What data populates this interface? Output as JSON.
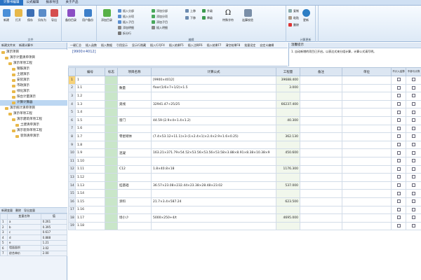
{
  "tabs": [
    "计算书编辑",
    "公式编辑",
    "报表导出",
    "关于产品"
  ],
  "ribbon": {
    "file_group": {
      "title": "文件",
      "buttons": [
        "新建",
        "打开",
        "保存",
        "另存为",
        "导出"
      ]
    },
    "user_group": {
      "buttons": [
        "备份目录",
        "用户备份"
      ]
    },
    "edit_group": {
      "title": "编辑",
      "big_button": "添加目录",
      "small_buttons": [
        "插入分部",
        "插入分项",
        "插入子目",
        "添加分部",
        "添加分项",
        "添加子目",
        "插入明细",
        "添加明细",
        "拆分行"
      ],
      "arrow_buttons": [
        "上移",
        "下移",
        "升级",
        "降级"
      ],
      "symbols_label": "特殊字符",
      "calc_label": "连算校验"
    },
    "delete_group": {
      "buttons": [
        "复制",
        "粘贴",
        "删除"
      ]
    },
    "update_group": {
      "title": "计算更新",
      "button": "更新"
    }
  },
  "left_panel": {
    "toolbar": [
      "新建文件夹",
      "新建计算书"
    ],
    "tree": [
      {
        "label": "演示项目",
        "level": 0
      },
      {
        "label": "演示计量清单项目",
        "level": 1
      },
      {
        "label": "演示单项工程",
        "level": 2
      },
      {
        "label": "钢筋演示",
        "level": 3
      },
      {
        "label": "土建演示",
        "level": 3
      },
      {
        "label": "安装演示",
        "level": 3
      },
      {
        "label": "市政演示",
        "level": 3
      },
      {
        "label": "绿化演示",
        "level": 3
      },
      {
        "label": "阳台计量演示",
        "level": 3
      },
      {
        "label": "计算计算器",
        "level": 3,
        "selected": true
      },
      {
        "label": "演示统计清单项目",
        "level": 1
      },
      {
        "label": "演示单项工程",
        "level": 2
      },
      {
        "label": "演示建筑单项工程",
        "level": 3
      },
      {
        "label": "土建清单演示",
        "level": 4
      },
      {
        "label": "演示装饰单项工程",
        "level": 3
      },
      {
        "label": "装饰清单演示",
        "level": 4
      }
    ],
    "bottom_toolbar": [
      "新建变量",
      "删除",
      "导出变量"
    ],
    "var_headers": [
      "变量名称",
      "值"
    ],
    "variables": [
      {
        "idx": "1",
        "name": "a",
        "value": "0.261"
      },
      {
        "idx": "2",
        "name": "b",
        "value": "0.395"
      },
      {
        "idx": "3",
        "name": "c",
        "value": "0.617"
      },
      {
        "idx": "4",
        "name": "d",
        "value": "0.888"
      },
      {
        "idx": "5",
        "name": "e",
        "value": "1.21"
      },
      {
        "idx": "6",
        "name": "墙面面积",
        "value": "3.02"
      },
      {
        "idx": "7",
        "name": "综合单价",
        "value": "2.00"
      }
    ]
  },
  "formula_bar": {
    "tools": [
      "一键汇总",
      "插入函数",
      "插入数据",
      "引用显示",
      "显示行隐藏",
      "插入行号F4",
      "插入结果F5",
      "插入注释F6",
      "插入结果F7",
      "清空结果F8",
      "批量设定",
      "自定义编辑"
    ],
    "value": "[9900×4012]"
  },
  "reminder": {
    "title": "温馨提示",
    "body": "1. 自动新增的项目已开启。以表达式来分组计算，计算公式请写明。"
  },
  "grid": {
    "headers": [
      "编号",
      "标志",
      "项目名称",
      "计算公式",
      "工程量",
      "备注",
      "单位",
      "不计入结算",
      "不参与计算"
    ],
    "rows": [
      {
        "rn": "1",
        "code": "1",
        "name": "",
        "formula": "[9900×4012]",
        "qty": "39688.400",
        "selected": true
      },
      {
        "rn": "2",
        "code": "1.1",
        "name": "数量",
        "formula": "floor(1/6×7+1/2)×1.5",
        "qty": "3.000"
      },
      {
        "rn": "3",
        "code": "1.2",
        "name": "",
        "formula": "",
        "qty": ""
      },
      {
        "rn": "4",
        "code": "1.3",
        "name": "奥线",
        "formula": "32941.47÷25/25",
        "qty": "66237.400"
      },
      {
        "rn": "5",
        "code": "1.4",
        "name": "",
        "formula": "",
        "qty": ""
      },
      {
        "rn": "6",
        "code": "1.5",
        "name": "窗门",
        "formula": "44.59-(2.9×4+1.4×1.2)",
        "qty": "40.300"
      },
      {
        "rn": "7",
        "code": "1.6",
        "name": "",
        "formula": "",
        "qty": ""
      },
      {
        "rn": "8",
        "code": "1.7",
        "name": "零星砌体",
        "formula": "(7.4×53.12+11.1)×3-(1×2.4×1)×2.4×2.9×1.6×0.25)",
        "qty": "362.130"
      },
      {
        "rn": "9",
        "code": "1.8",
        "name": "",
        "formula": "",
        "qty": ""
      },
      {
        "rn": "10",
        "code": "1.9",
        "name": "混凝",
        "formula": "163.21×371.79×54.52×53.56×53.56×53.58×3.88×8.91×8.38×10.38×9",
        "qty": "450.600"
      },
      {
        "rn": "11",
        "code": "1.10",
        "name": "",
        "formula": "",
        "qty": ""
      },
      {
        "rn": "12",
        "code": "1.11",
        "name": "C12",
        "formula": "1.8×40.8×18",
        "qty": "1176.300"
      },
      {
        "rn": "13",
        "code": "1.12",
        "name": "",
        "formula": "",
        "qty": ""
      },
      {
        "rn": "14",
        "code": "1.13",
        "name": "挂基础",
        "formula": "36.57×23.08×232.44×23.38×28.48×23.02",
        "qty": "537.000"
      },
      {
        "rn": "15",
        "code": "1.14",
        "name": "",
        "formula": "",
        "qty": ""
      },
      {
        "rn": "16",
        "code": "1.15",
        "name": "涂料",
        "formula": "21.7×3.4×587.24",
        "qty": "623.500"
      },
      {
        "rn": "17",
        "code": "1.16",
        "name": "",
        "formula": "",
        "qty": ""
      },
      {
        "rn": "18",
        "code": "1.17",
        "name": "场小少",
        "formula": "5000×250+4/t",
        "qty": "4695.000"
      },
      {
        "rn": "19",
        "code": "1.18",
        "name": "",
        "formula": "",
        "qty": ""
      }
    ]
  },
  "colors": {
    "ribbon_tab_active": "#2a73c4",
    "mark_column": "#c9e6c9",
    "selected_tree_row": "#bcd7f2"
  }
}
